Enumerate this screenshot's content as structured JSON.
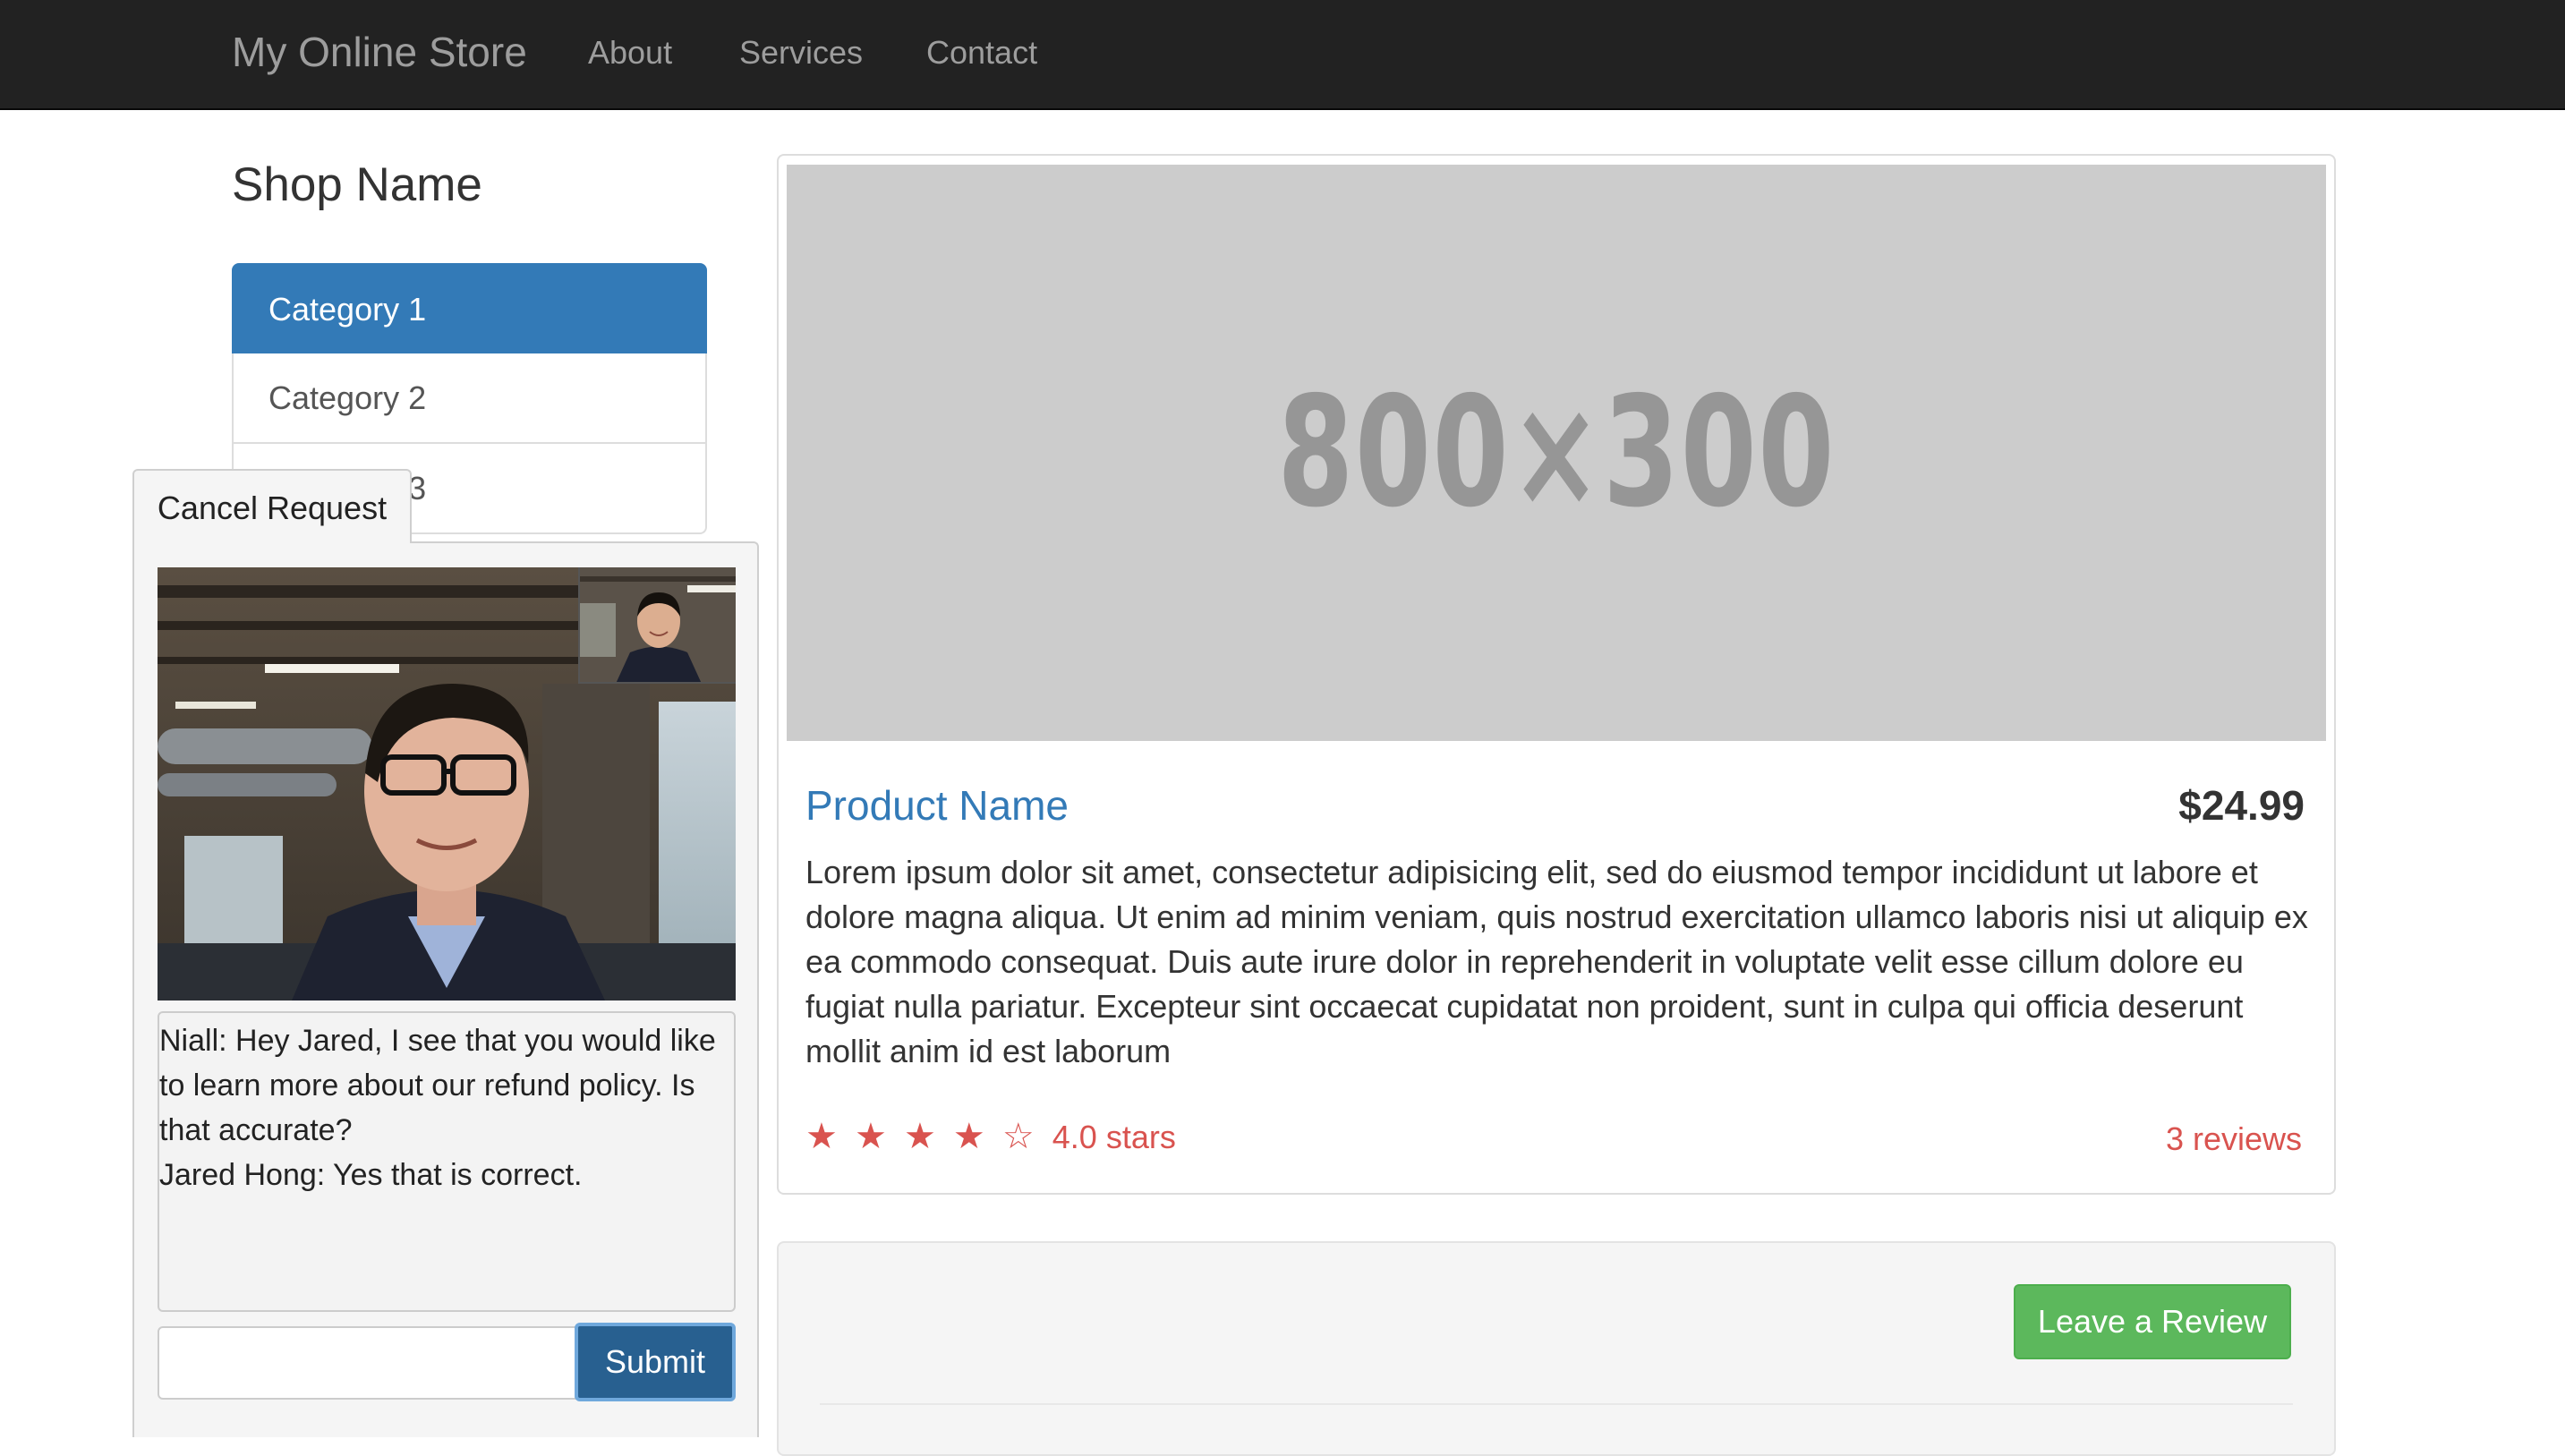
{
  "navbar": {
    "brand": "My Online Store",
    "links": [
      "About",
      "Services",
      "Contact"
    ]
  },
  "sidebar": {
    "title": "Shop Name",
    "categories": [
      "Category 1",
      "Category 2",
      "Category 3"
    ],
    "active_index": 0
  },
  "support": {
    "cancel_label": "Cancel Request",
    "chat": [
      "Niall: Hey Jared, I see that you would like to learn more about our refund policy. Is that accurate?",
      "Jared Hong: Yes that is correct."
    ],
    "input_value": "",
    "submit_label": "Submit"
  },
  "product": {
    "image_text": "800×300",
    "name": "Product Name",
    "price": "$24.99",
    "description": "Lorem ipsum dolor sit amet, consectetur adipisicing elit, sed do eiusmod tempor incididunt ut labore et dolore magna aliqua. Ut enim ad minim veniam, quis nostrud exercitation ullamco laboris nisi ut aliquip ex ea commodo consequat. Duis aute irure dolor in reprehenderit in voluptate velit esse cillum dolore eu fugiat nulla pariatur. Excepteur sint occaecat cupidatat non proident, sunt in culpa qui officia deserunt mollit anim id est laborum",
    "rating_stars": "★ ★ ★ ★ ☆",
    "rating_value": 4.0,
    "rating_text": "4.0 stars",
    "reviews_text": "3 reviews"
  },
  "reviews": {
    "leave_review_label": "Leave a Review"
  },
  "colors": {
    "navbar_bg": "#222222",
    "primary": "#337ab7",
    "success": "#5cb85c",
    "rating": "#d9534f"
  }
}
